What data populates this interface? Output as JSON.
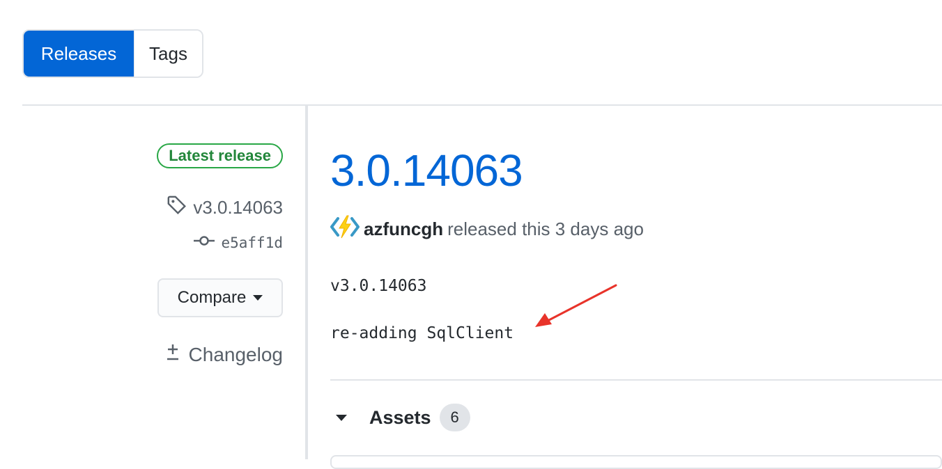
{
  "tabs": {
    "releases_label": "Releases",
    "tags_label": "Tags"
  },
  "sidebar": {
    "latest_badge": "Latest release",
    "tag_name": "v3.0.14063",
    "commit_sha": "e5aff1d",
    "compare_label": "Compare",
    "changelog_label": "Changelog"
  },
  "release": {
    "title": "3.0.14063",
    "author": "azfuncgh",
    "released_text": "released this 3 days ago",
    "notes": [
      "v3.0.14063",
      "re-adding SqlClient"
    ],
    "assets_label": "Assets",
    "assets_count": "6"
  },
  "icons": {
    "tag": "tag-icon",
    "commit": "commit-icon",
    "caret": "caret-down-icon",
    "changelog": "diff-icon",
    "author_avatar": "azure-functions-icon",
    "annotation": "red-arrow"
  },
  "colors": {
    "accent": "#0366d6",
    "latest_green": "#28a745",
    "annotation_red": "#e8332a"
  }
}
